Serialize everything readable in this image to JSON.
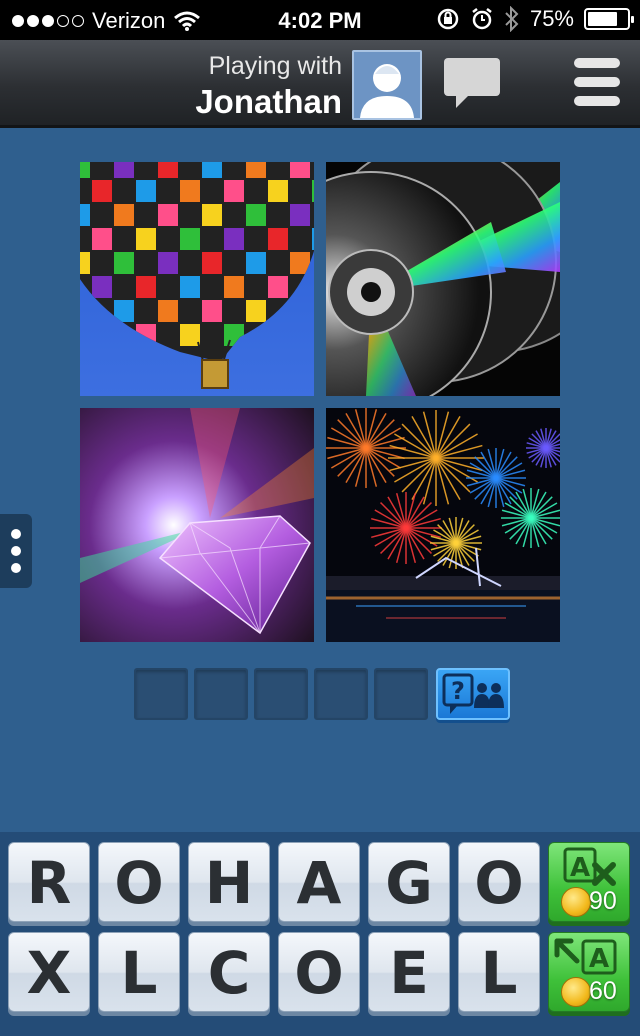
{
  "status_bar": {
    "carrier": "Verizon",
    "time": "4:02 PM",
    "battery": "75%",
    "battery_level": 0.75,
    "signal_bars": 3
  },
  "header": {
    "playing_with_label": "Playing with",
    "opponent_name": "Jonathan"
  },
  "puzzle": {
    "images": [
      {
        "name": "hot-air-balloon"
      },
      {
        "name": "compact-discs"
      },
      {
        "name": "diamond"
      },
      {
        "name": "fireworks"
      }
    ],
    "answer_length": 5,
    "hint_icon": "question-people-icon"
  },
  "keyboard": {
    "row1": [
      "R",
      "O",
      "H",
      "A",
      "G",
      "O"
    ],
    "row2": [
      "X",
      "L",
      "C",
      "O",
      "E",
      "L"
    ],
    "remove_letters": {
      "icon": "remove-letter-icon",
      "cost": "90"
    },
    "reveal_letter": {
      "icon": "reveal-letter-icon",
      "cost": "60"
    }
  },
  "colors": {
    "background": "#2f5f8e",
    "hint_button": "#1a78d6",
    "power_button": "#3fc13a"
  }
}
